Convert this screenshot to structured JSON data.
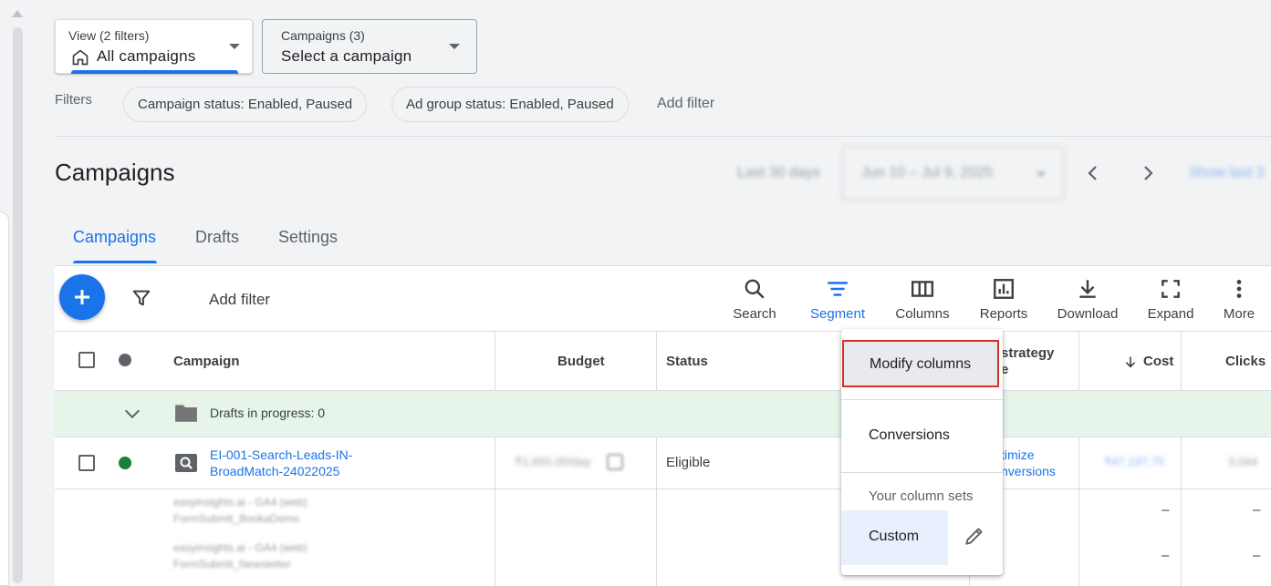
{
  "view_picker": {
    "label": "View (2 filters)",
    "value": "All campaigns"
  },
  "campaign_picker": {
    "label": "Campaigns (3)",
    "value": "Select a campaign"
  },
  "filters": {
    "label": "Filters",
    "chips": [
      "Campaign status: Enabled, Paused",
      "Ad group status: Enabled, Paused"
    ],
    "add_filter": "Add filter"
  },
  "page_title": "Campaigns",
  "date": {
    "range_label": "Last 30 days",
    "range_value": "Jun 10 – Jul 9, 2025",
    "show_last": "Show last 3"
  },
  "tabs": [
    "Campaigns",
    "Drafts",
    "Settings"
  ],
  "toolbar": {
    "add_filter": "Add filter",
    "tools": [
      {
        "label": "Search",
        "icon": "search-icon"
      },
      {
        "label": "Segment",
        "icon": "segment-icon"
      },
      {
        "label": "Columns",
        "icon": "columns-icon"
      },
      {
        "label": "Reports",
        "icon": "reports-icon"
      },
      {
        "label": "Download",
        "icon": "download-icon"
      },
      {
        "label": "Expand",
        "icon": "expand-icon"
      },
      {
        "label": "More",
        "icon": "more-vert-icon"
      }
    ]
  },
  "table": {
    "headers": {
      "campaign": "Campaign",
      "budget": "Budget",
      "status": "Status",
      "bid_strategy_1": "strategy",
      "bid_strategy_2": "e",
      "cost": "Cost",
      "clicks": "Clicks"
    },
    "drafts_row": {
      "text": "Drafts in progress: 0"
    },
    "campaign_row": {
      "name_line1": "EI-001-Search-Leads-IN-",
      "name_line2": "BroadMatch-24022025",
      "budget": "₹1,655.00/day",
      "status": "Eligible",
      "bid_strategy_1": "timize",
      "bid_strategy_2": "nversions",
      "cost": "₹47,197.75",
      "clicks": "3,044"
    },
    "sub_rows": [
      {
        "line1": "easyinsights.ai - GA4 (web)",
        "line2": "FormSubmit_BookaDemo",
        "cost": "–",
        "clicks": "–"
      },
      {
        "line1": "easyinsights.ai - GA4 (web)",
        "line2": "FormSubmit_Newsletter",
        "cost": "–",
        "clicks": "–"
      }
    ]
  },
  "columns_menu": {
    "modify": "Modify columns",
    "conversions": "Conversions",
    "section": "Your column sets",
    "custom": "Custom"
  },
  "colors": {
    "accent": "#1a73e8",
    "eligible": "#188038",
    "highlight": "#d93025",
    "drafts_bg": "#e6f4ea"
  }
}
